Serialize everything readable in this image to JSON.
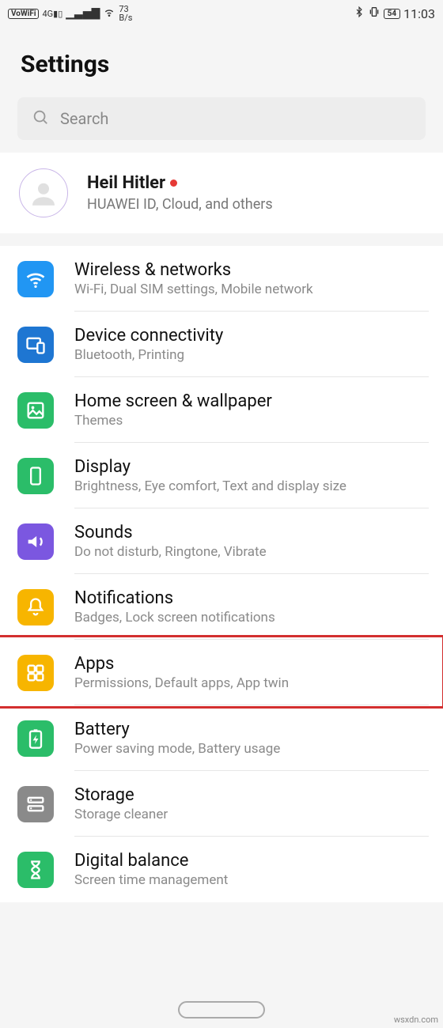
{
  "status": {
    "vowifi": "VoWiFi",
    "signal": "4G",
    "speed_top": "73",
    "speed_bottom": "B/s",
    "battery": "54",
    "time": "11:03"
  },
  "header": {
    "title": "Settings"
  },
  "search": {
    "placeholder": "Search"
  },
  "account": {
    "name": "Heil Hitler",
    "sub": "HUAWEI ID, Cloud, and others"
  },
  "items": [
    {
      "icon": "wifi-icon",
      "color": "bg-blue",
      "title": "Wireless & networks",
      "sub": "Wi-Fi, Dual SIM settings, Mobile network"
    },
    {
      "icon": "device-icon",
      "color": "bg-dblue",
      "title": "Device connectivity",
      "sub": "Bluetooth, Printing"
    },
    {
      "icon": "wallpaper-icon",
      "color": "bg-green",
      "title": "Home screen & wallpaper",
      "sub": "Themes"
    },
    {
      "icon": "display-icon",
      "color": "bg-green",
      "title": "Display",
      "sub": "Brightness, Eye comfort, Text and display size"
    },
    {
      "icon": "sound-icon",
      "color": "bg-purple",
      "title": "Sounds",
      "sub": "Do not disturb, Ringtone, Vibrate"
    },
    {
      "icon": "bell-icon",
      "color": "bg-yellow",
      "title": "Notifications",
      "sub": "Badges, Lock screen notifications"
    },
    {
      "icon": "apps-icon",
      "color": "bg-yellow",
      "title": "Apps",
      "sub": "Permissions, Default apps, App twin"
    },
    {
      "icon": "battery-icon",
      "color": "bg-green",
      "title": "Battery",
      "sub": "Power saving mode, Battery usage"
    },
    {
      "icon": "storage-icon",
      "color": "bg-gray",
      "title": "Storage",
      "sub": "Storage cleaner"
    },
    {
      "icon": "hourglass-icon",
      "color": "bg-green",
      "title": "Digital balance",
      "sub": "Screen time management"
    }
  ],
  "highlight_index": 6,
  "watermark": "wsxdn.com"
}
